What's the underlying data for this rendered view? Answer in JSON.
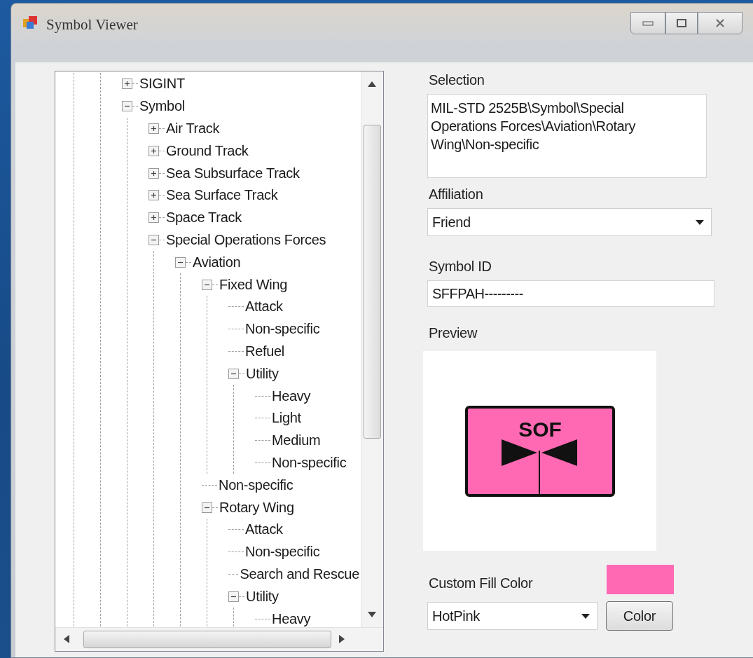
{
  "window": {
    "title": "Symbol Viewer"
  },
  "tree": {
    "items": [
      {
        "label": "SIGINT",
        "expanded": false
      },
      {
        "label": "Symbol",
        "expanded": true,
        "children": [
          {
            "label": "Air Track",
            "expanded": false
          },
          {
            "label": "Ground Track",
            "expanded": false
          },
          {
            "label": "Sea Subsurface Track",
            "expanded": false
          },
          {
            "label": "Sea Surface Track",
            "expanded": false
          },
          {
            "label": "Space Track",
            "expanded": false
          },
          {
            "label": "Special Operations Forces",
            "expanded": true,
            "children": [
              {
                "label": "Aviation",
                "expanded": true,
                "children": [
                  {
                    "label": "Fixed Wing",
                    "expanded": true,
                    "children": [
                      {
                        "label": "Attack"
                      },
                      {
                        "label": "Non-specific"
                      },
                      {
                        "label": "Refuel"
                      },
                      {
                        "label": "Utility",
                        "expanded": true,
                        "children": [
                          {
                            "label": "Heavy"
                          },
                          {
                            "label": "Light"
                          },
                          {
                            "label": "Medium"
                          },
                          {
                            "label": "Non-specific"
                          }
                        ]
                      }
                    ]
                  },
                  {
                    "label": "Non-specific"
                  },
                  {
                    "label": "Rotary Wing",
                    "expanded": true,
                    "children": [
                      {
                        "label": "Attack"
                      },
                      {
                        "label": "Non-specific"
                      },
                      {
                        "label": "Search and Rescue"
                      },
                      {
                        "label": "Utility",
                        "expanded": true,
                        "children": [
                          {
                            "label": "Heavy"
                          }
                        ]
                      }
                    ]
                  }
                ]
              }
            ]
          }
        ]
      }
    ]
  },
  "selection": {
    "label": "Selection",
    "value": "MIL-STD 2525B\\Symbol\\Special Operations Forces\\Aviation\\Rotary Wing\\Non-specific"
  },
  "affiliation": {
    "label": "Affiliation",
    "value": "Friend"
  },
  "symbol_id": {
    "label": "Symbol ID",
    "value": "SFFPAH---------"
  },
  "preview": {
    "label": "Preview",
    "symbol_text": "SOF"
  },
  "custom_fill": {
    "label": "Custom Fill Color",
    "color": "#ff69b4",
    "value": "HotPink",
    "button": "Color"
  }
}
